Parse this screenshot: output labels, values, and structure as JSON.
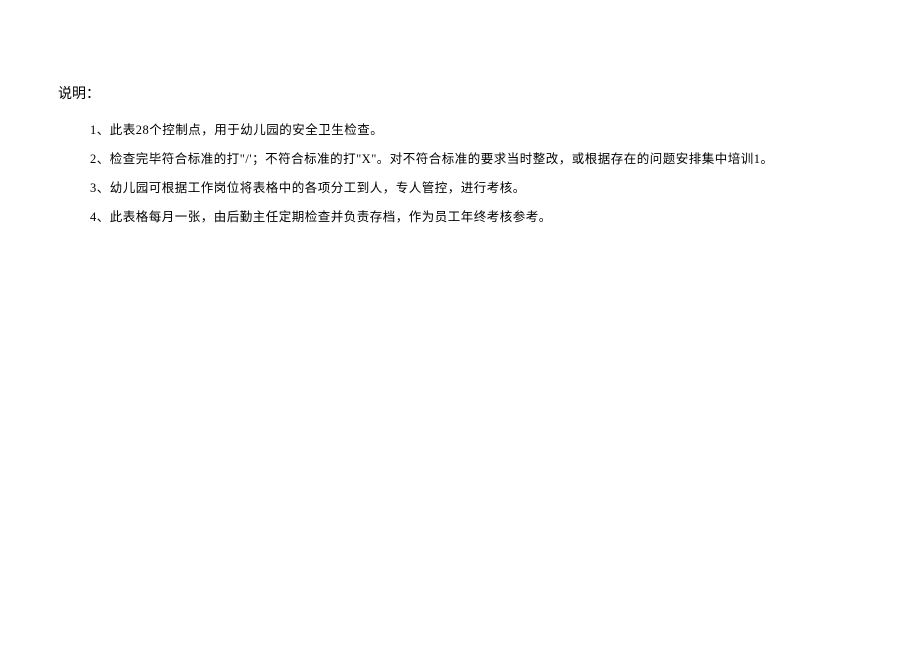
{
  "title": "说明：",
  "items": [
    "1、此表28个控制点，用于幼儿园的安全卫生检查。",
    "2、检查完毕符合标准的打\"/'；不符合标准的打\"X\"。对不符合标准的要求当时整改，或根据存在的问题安排集中培训1。",
    "3、幼儿园可根据工作岗位将表格中的各项分工到人，专人管控，进行考核。",
    "4、此表格每月一张，由后勤主任定期检查并负责存档，作为员工年终考核参考。"
  ]
}
